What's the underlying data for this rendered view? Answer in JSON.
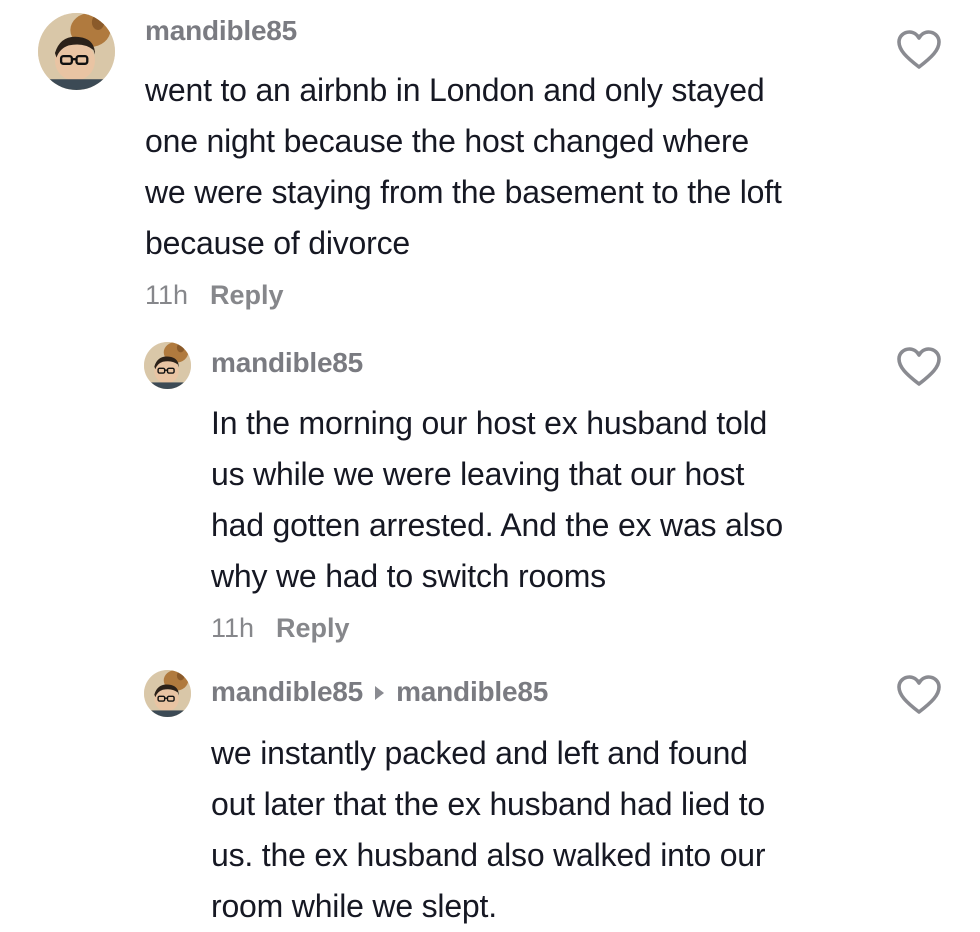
{
  "comments": [
    {
      "username": "mandible85",
      "text": "went to an airbnb in London and only stayed\none night because the host changed where\nwe were staying from the basement to the loft\nbecause of divorce",
      "time": "11h",
      "reply_label": "Reply"
    },
    {
      "username": "mandible85",
      "text": "In the morning our host ex husband told\nus while we were leaving that our host\nhad gotten arrested. And the ex was also\nwhy we had to switch rooms",
      "time": "11h",
      "reply_label": "Reply"
    },
    {
      "username": "mandible85",
      "reply_to": "mandible85",
      "text": "we instantly packed and left and found\nout later that the ex husband had lied to\nus. the ex husband also walked into our\nroom while we slept."
    }
  ],
  "icons": {
    "like": "heart-outline-icon",
    "reply_to": "caret-right-icon"
  },
  "colors": {
    "username": "#7a7b81",
    "text": "#161823",
    "meta": "#86878b",
    "icon": "#8a8b91"
  }
}
